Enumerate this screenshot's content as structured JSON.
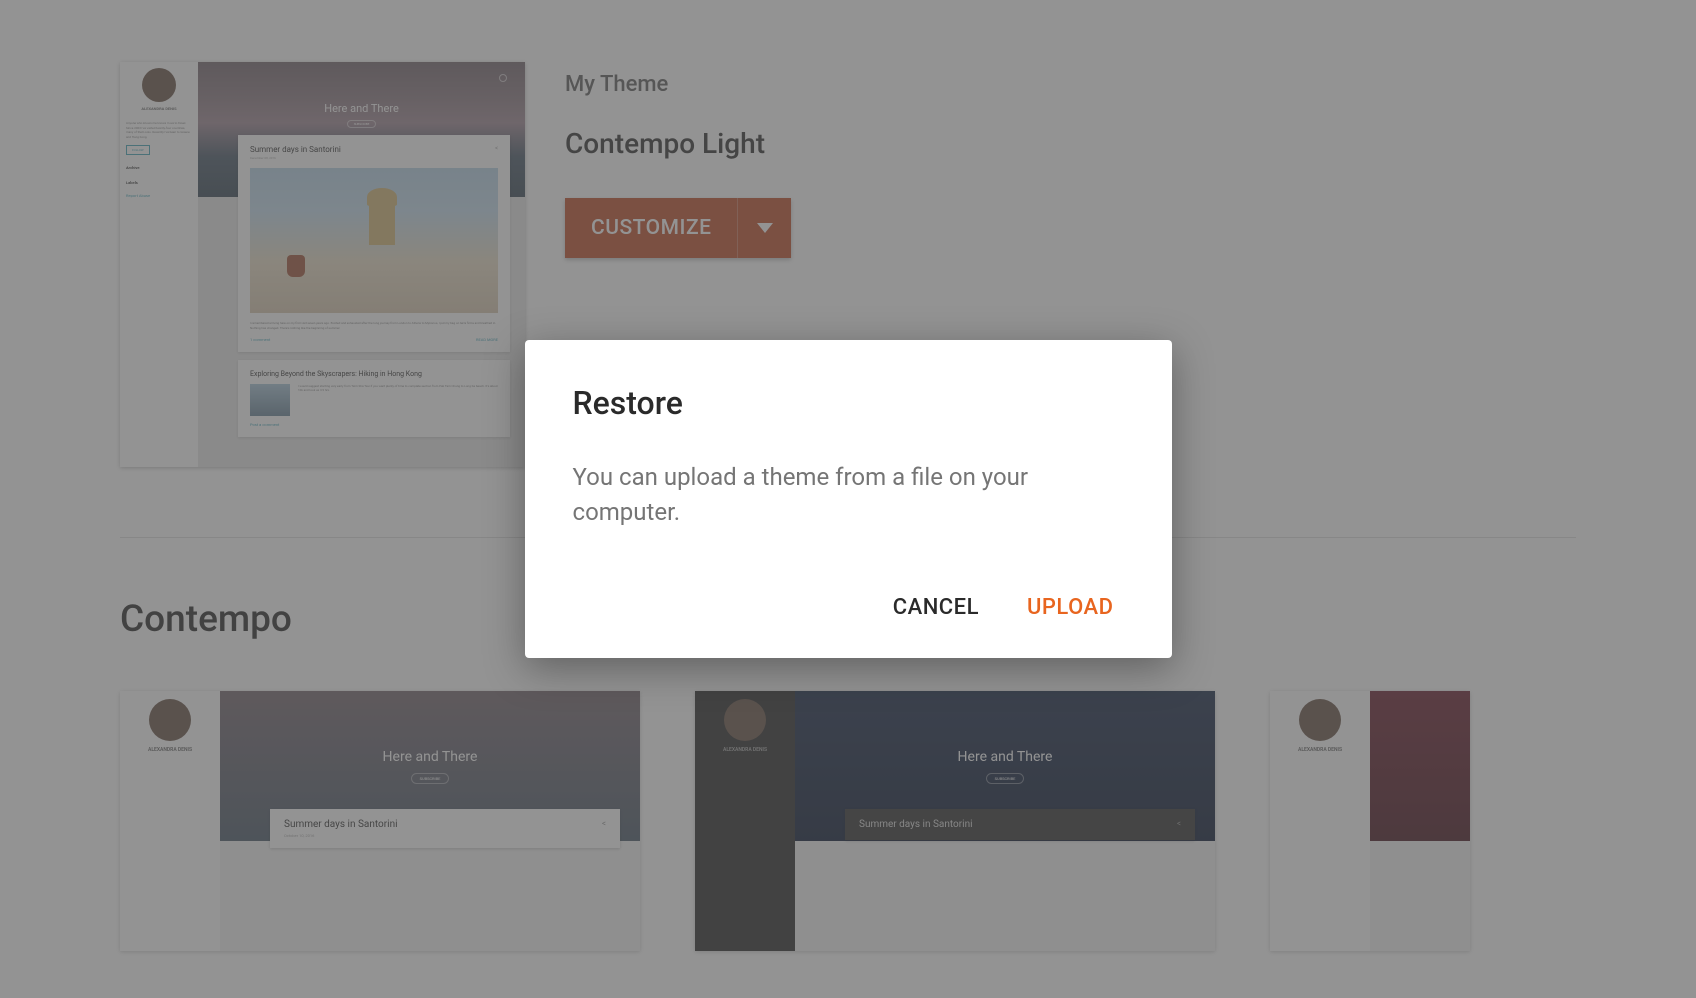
{
  "my_theme": {
    "label": "My Theme",
    "name": "Contempo Light",
    "customize_label": "CUSTOMIZE"
  },
  "preview": {
    "sidebar_name": "ALEXANDRA DENIS",
    "sidebar_text": "Anyone who knows me knows I love to travel. Since 2003 I've visited twenty-four countries, many of them solo. Recently I've been to Greece and Hong Kong.",
    "archive": "Archive",
    "labels": "Labels",
    "report_abuse": "Report Abuse",
    "hero_title": "Here and There",
    "post1_title": "Summer days in Santorini",
    "post1_date": "December 08, 2016",
    "post1_text": "I remembered arriving here on my first visit seven years ago. Excited and exhausted after the long journey from London to Athens to Mykonos, I put my bag on terra firma and breathed in. Nothing has changed. There's nothing like the beginning of summer.",
    "post1_comment": "1 comment",
    "post1_read": "READ MORE",
    "post2_title": "Exploring Beyond the Skyscrapers: Hiking in Hong Kong",
    "post2_text": "I would suggest starting very early from Tsim Sha Tsui if you want plenty of time to complete section from Pak Tam Chung to Long Ke beach. It's about 10k and took us 3.5 hrs.",
    "post2_comment": "Post a comment"
  },
  "section": {
    "label": "Contempo"
  },
  "theme_cards": {
    "light": {
      "hero_title": "Here and There",
      "post_title": "Summer days in Santorini",
      "post_date": "October 10, 2016",
      "sidebar_name": "ALEXANDRA DENIS"
    },
    "dark": {
      "hero_title": "Here and There",
      "post_title": "Summer days in Santorini",
      "sidebar_name": "ALEXANDRA DENIS"
    },
    "red": {
      "sidebar_name": "ALEXANDRA DENIS"
    }
  },
  "modal": {
    "title": "Restore",
    "text": "You can upload a theme from a file on your computer.",
    "cancel": "CANCEL",
    "upload": "UPLOAD"
  }
}
